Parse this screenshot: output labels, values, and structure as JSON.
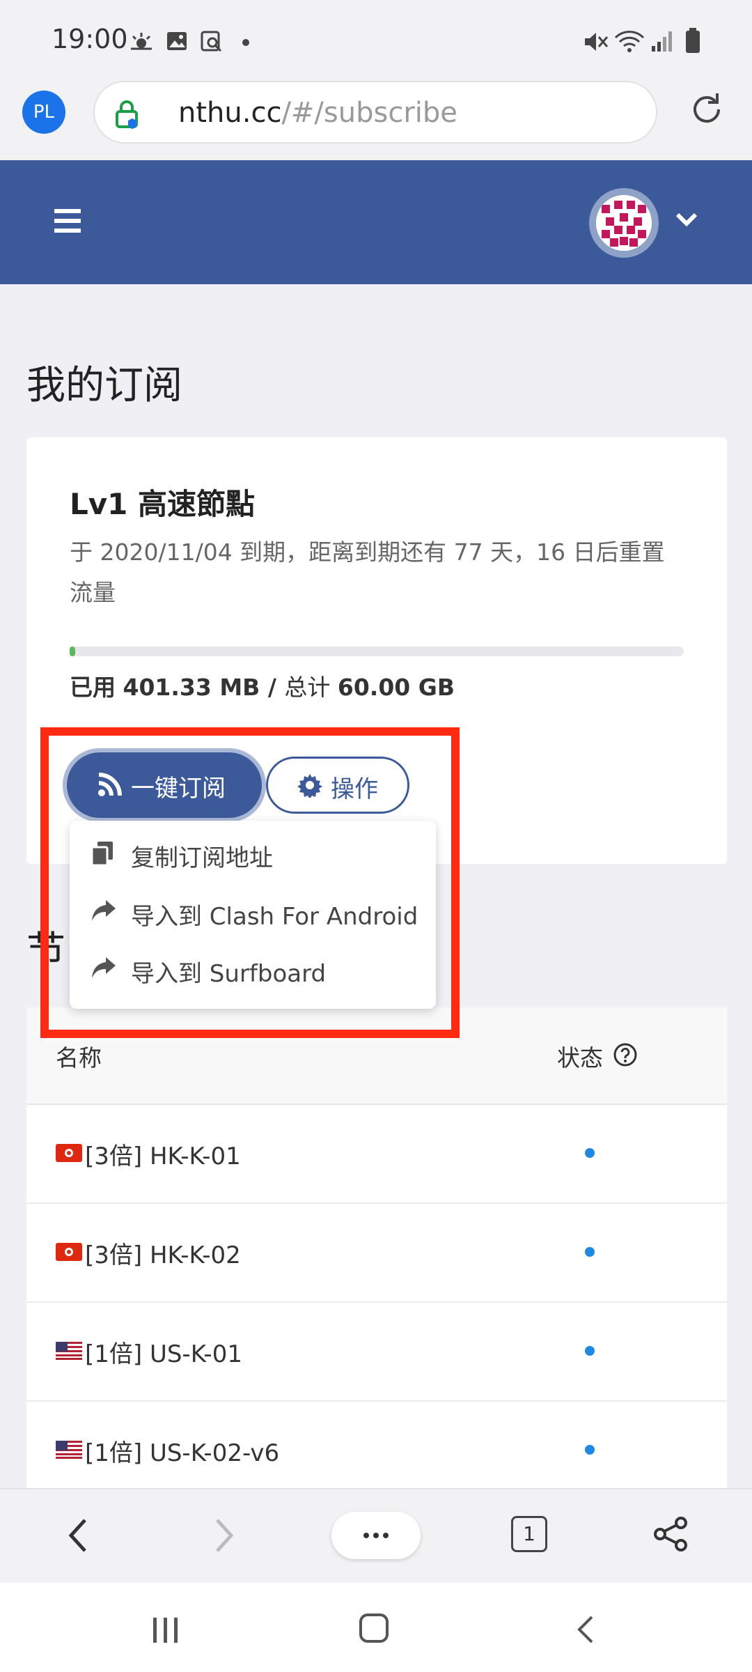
{
  "status_bar": {
    "time": "19:00"
  },
  "browser": {
    "profile_initials": "PL",
    "url_host": "nthu.cc",
    "url_path": "/#/subscribe",
    "tab_count": "1"
  },
  "page": {
    "title": "我的订阅",
    "nodes_title_partial": "节"
  },
  "subscription": {
    "plan_name": "Lv1 高速節點",
    "description": "于 2020/11/04 到期，距离到期还有 77 天，16 日后重置流量",
    "usage_used_label": "已用",
    "usage_used": "401.33 MB",
    "usage_sep": " / ",
    "usage_total_label": "总计",
    "usage_total": "60.00 GB",
    "usage_fraction": 0.0065,
    "subscribe_button": "一键订阅",
    "actions_button": "操作"
  },
  "dropdown": {
    "items": [
      {
        "label": "复制订阅地址",
        "icon": "copy-icon"
      },
      {
        "label": "导入到 Clash For Android",
        "icon": "share-arrow-icon"
      },
      {
        "label": "导入到 Surfboard",
        "icon": "share-arrow-icon"
      }
    ]
  },
  "table": {
    "headers": {
      "name": "名称",
      "status": "状态"
    },
    "rows": [
      {
        "flag": "hk",
        "name": "[3倍] HK-K-01"
      },
      {
        "flag": "hk",
        "name": "[3倍] HK-K-02"
      },
      {
        "flag": "us",
        "name": "[1倍] US-K-01"
      },
      {
        "flag": "us",
        "name": "[1倍] US-K-02-v6"
      }
    ]
  },
  "colors": {
    "header": "#3c5a99",
    "highlight_box": "#ff2a12",
    "progress": "#5cb85c",
    "status_dot": "#1e88e5"
  }
}
